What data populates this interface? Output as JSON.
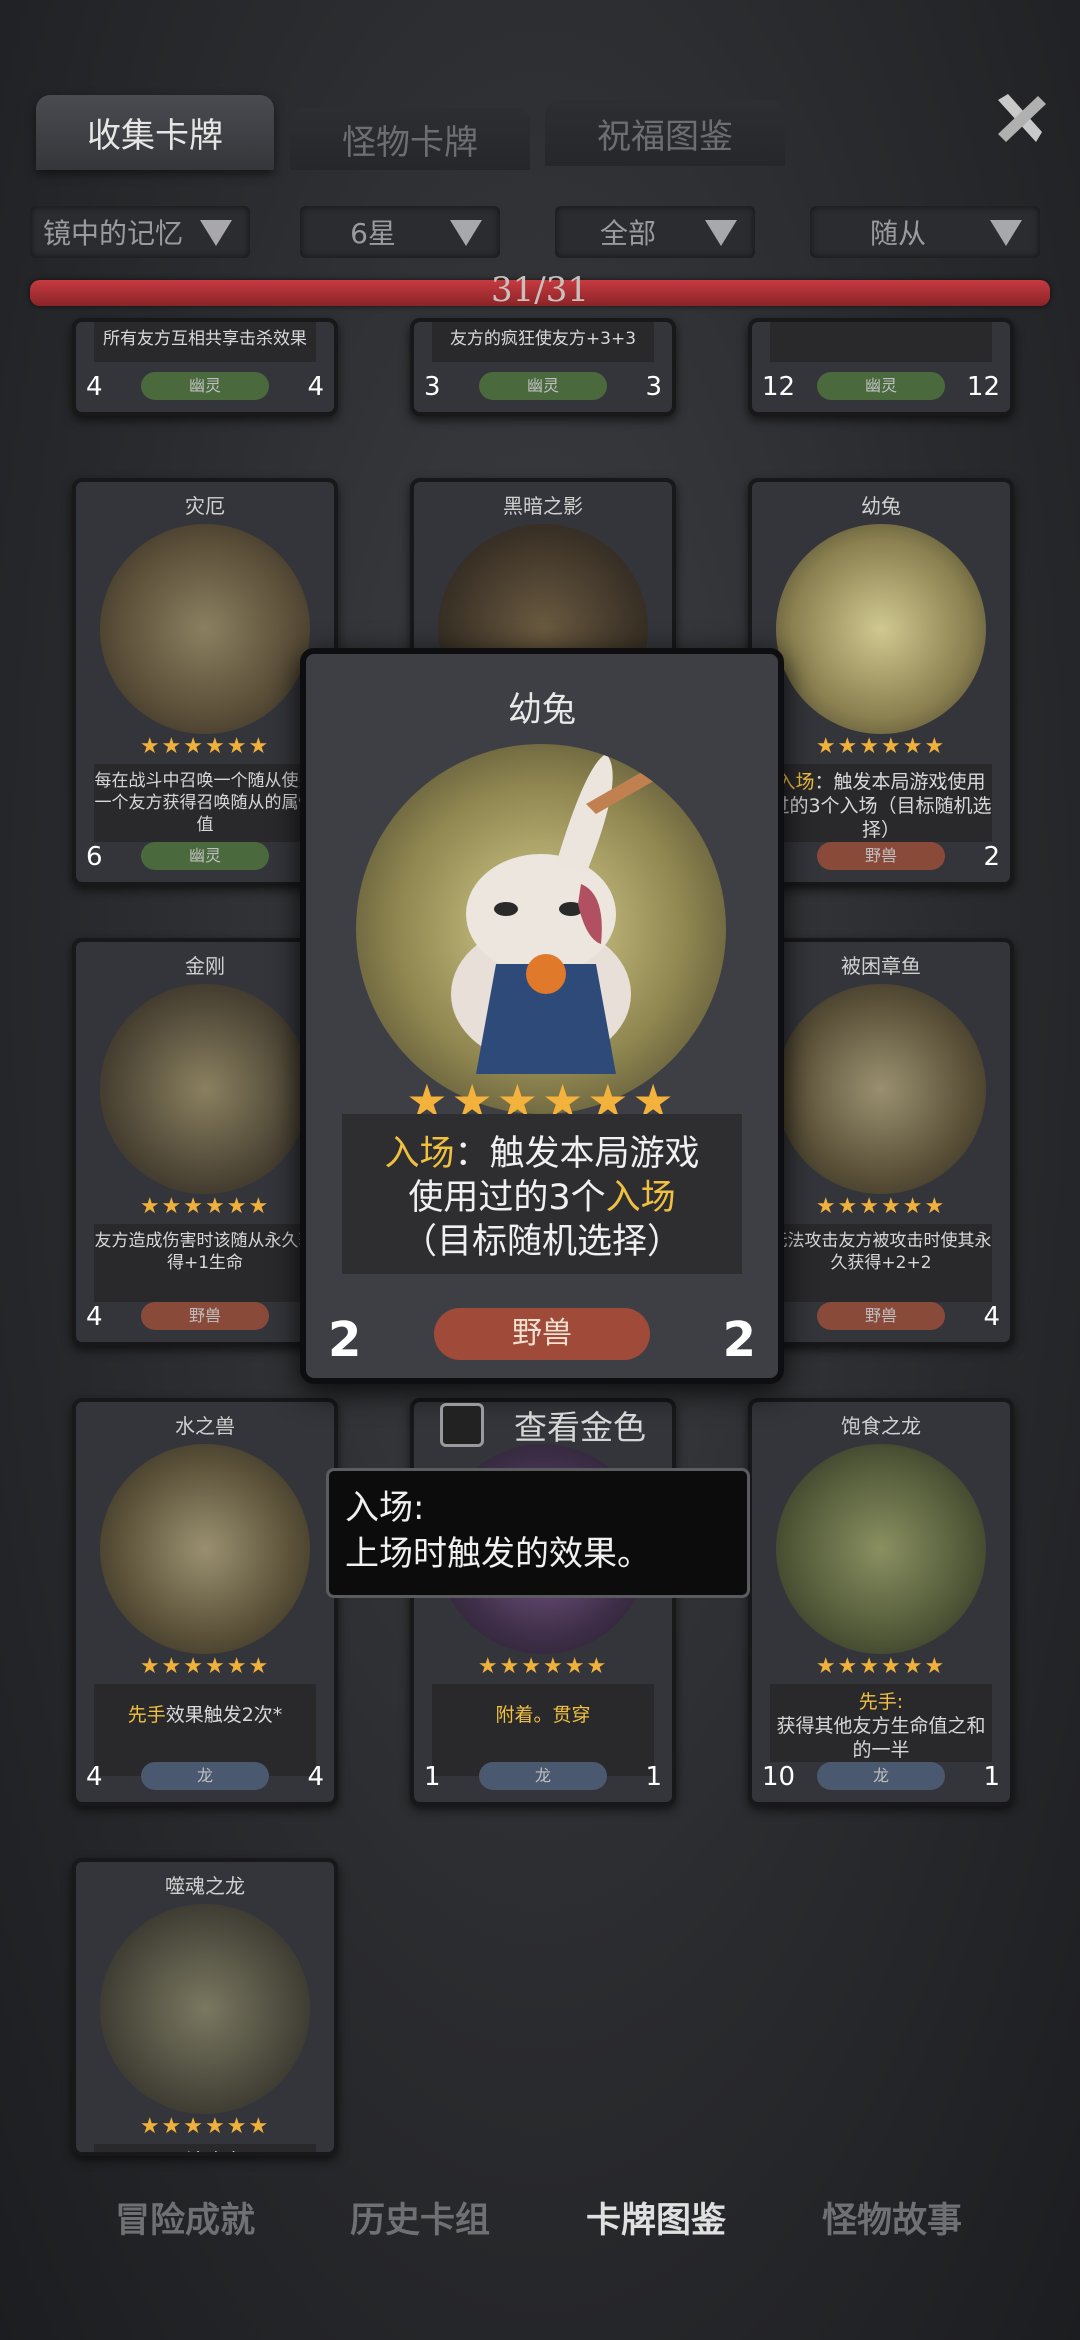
{
  "tabs": [
    "收集卡牌",
    "怪物卡牌",
    "祝福图鉴"
  ],
  "filters": [
    "镜中的记忆",
    "6星",
    "全部",
    "随从"
  ],
  "progress": {
    "text": "31/31",
    "fraction": 1.0
  },
  "top_row_partial": [
    {
      "desc": "所有友方互相共享击杀效果",
      "cost": "4",
      "tribe": "幽灵",
      "hp": "4"
    },
    {
      "desc": "友方的疯狂使友方+3+3",
      "cost": "3",
      "tribe": "幽灵",
      "hp": "3"
    },
    {
      "desc": "",
      "cost": "12",
      "tribe": "幽灵",
      "hp": "12"
    }
  ],
  "cards": [
    {
      "title": "灾厄",
      "desc": "每在战斗中召唤一个随从使另一个友方获得召唤随从的属性值",
      "cost": "6",
      "tribe": "幽灵",
      "hp": "6"
    },
    {
      "title": "黑暗之影",
      "desc": "",
      "cost": "",
      "tribe": "",
      "hp": ""
    },
    {
      "title": "幼兔",
      "desc_kw": "入场",
      "desc": "：触发本局游戏使用过的3个入场（目标随机选择）",
      "cost": "2",
      "tribe": "野兽",
      "hp": "2"
    },
    {
      "title": "金刚",
      "desc": "友方造成伤害时该随从永久获得+1生命",
      "cost": "4",
      "tribe": "野兽",
      "hp": "4"
    },
    {
      "title": "",
      "desc": "",
      "cost": "",
      "tribe": "",
      "hp": ""
    },
    {
      "title": "被困章鱼",
      "desc": "无法攻击友方被攻击时使其永久获得+2+2",
      "cost": "4",
      "tribe": "野兽",
      "hp": "4"
    },
    {
      "title": "水之兽",
      "desc_kw": "先手",
      "desc": "效果触发2次*",
      "cost": "4",
      "tribe": "龙",
      "hp": "4"
    },
    {
      "title": "",
      "desc": "附着。贯穿",
      "cost": "1",
      "tribe": "龙",
      "hp": "1"
    },
    {
      "title": "饱食之龙",
      "desc_kw": "先手:",
      "desc": "获得其他友方生命值之和的一半",
      "cost": "10",
      "tribe": "龙",
      "hp": "1"
    },
    {
      "title": "噬魂之龙",
      "desc": "无法攻击",
      "cost": "",
      "tribe": "",
      "hp": ""
    }
  ],
  "featured": {
    "title": "幼兔",
    "stars": "★★★★★★",
    "desc_line1_kw": "入场",
    "desc_line1": "：触发本局游戏",
    "desc_line2_pre": "使用过的3个",
    "desc_line2_kw": "入场",
    "desc_line3": "（目标随机选择）",
    "cost": "2",
    "tribe": "野兽",
    "hp": "2"
  },
  "gold_toggle": {
    "label": "查看金色",
    "checked": false
  },
  "tooltip": {
    "line1": "入场:",
    "line2": "上场时触发的效果。"
  },
  "bottom_nav": [
    "冒险成就",
    "历史卡组",
    "卡牌图鉴",
    "怪物故事"
  ],
  "colors": {
    "keyword": "#f0c040",
    "progress": "#c63a40",
    "beast_tribe": "#a04a3a",
    "dragon_tribe": "#4a5870",
    "ghost_tribe": "#4a6a3e"
  }
}
